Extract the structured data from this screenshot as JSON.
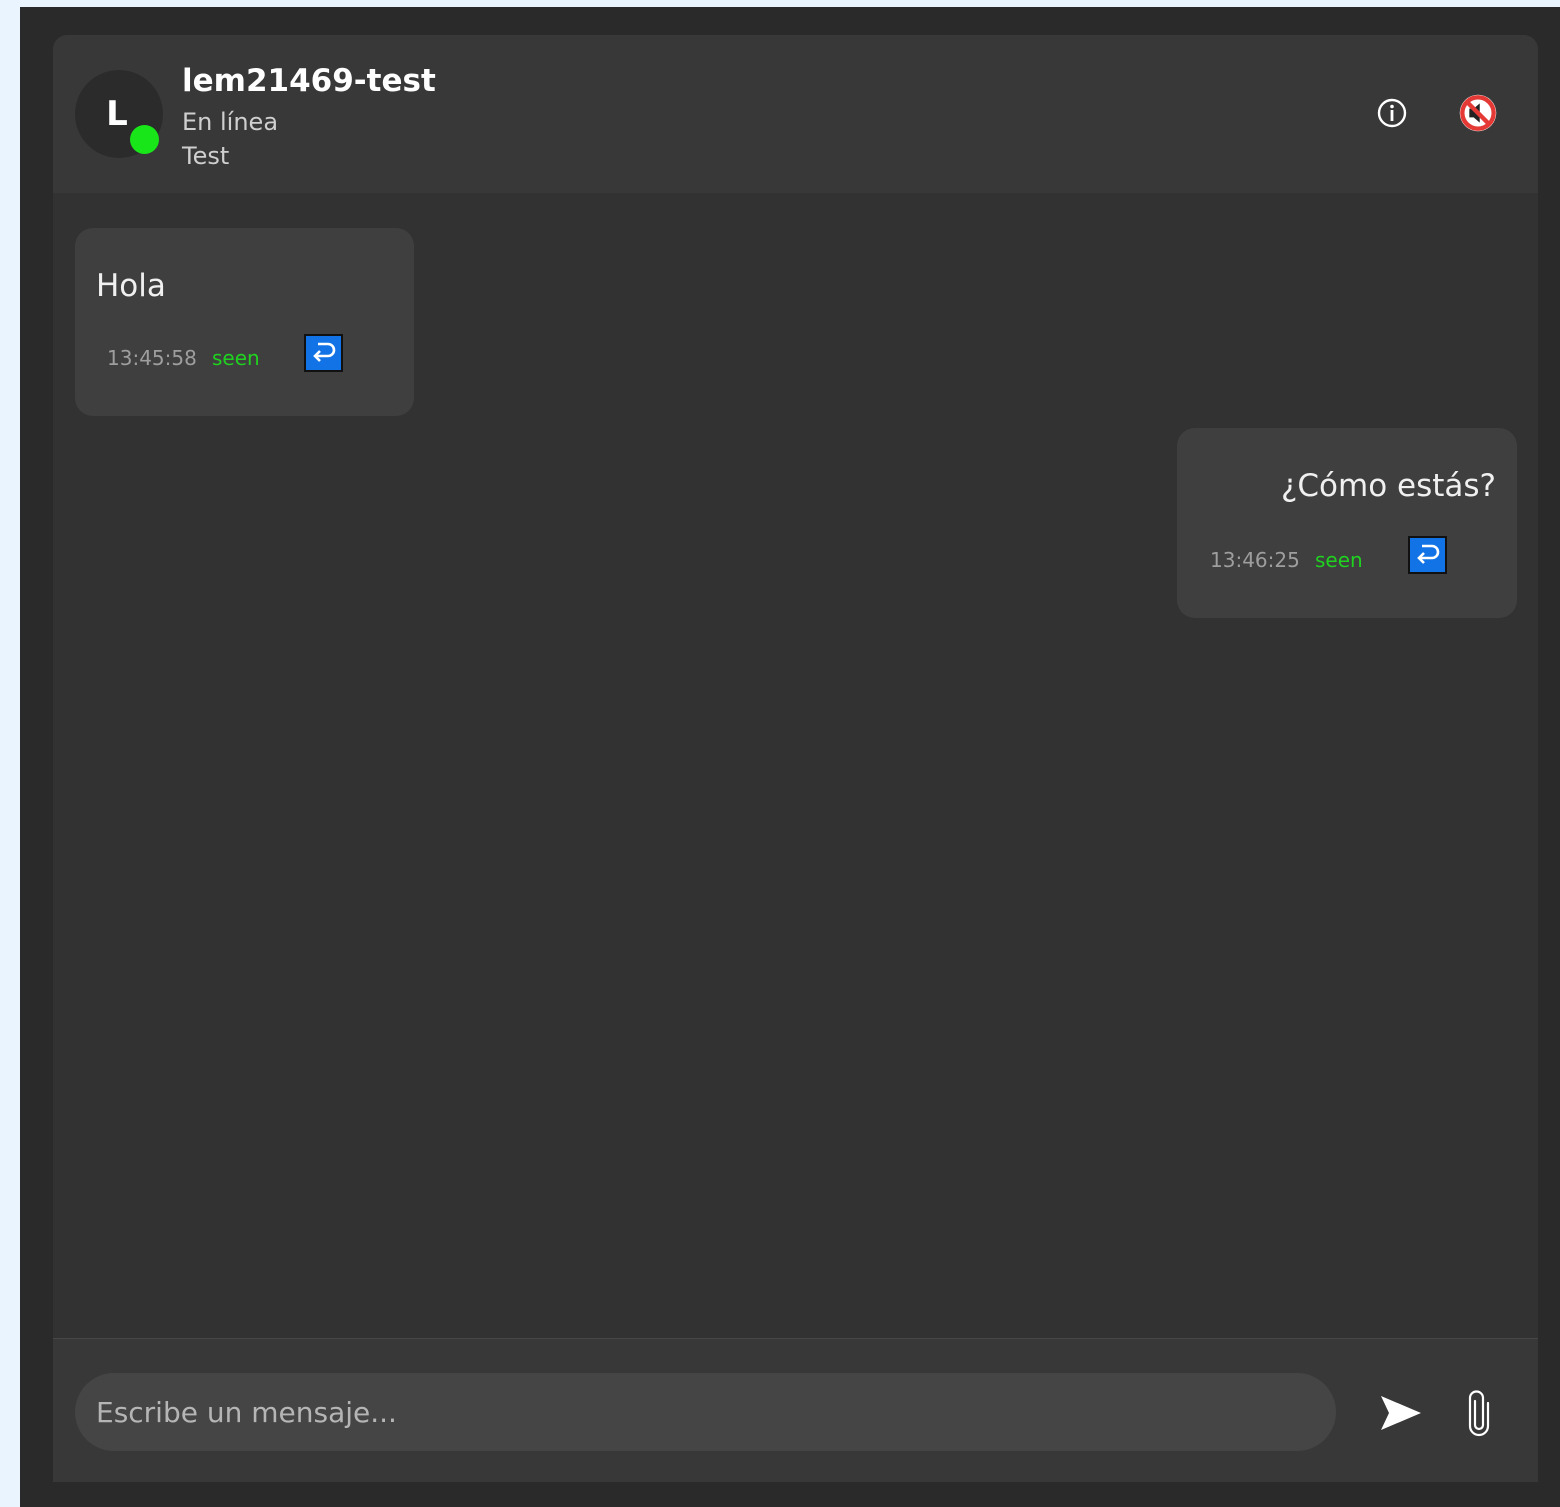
{
  "contact": {
    "initial": "L",
    "name": "lem21469-test",
    "status": "En línea",
    "description": "Test"
  },
  "header_icons": [
    "info-icon",
    "mute-icon"
  ],
  "messages": [
    {
      "text": "Hola",
      "time": "13:45:58",
      "status": "seen",
      "side": "left"
    },
    {
      "text": "¿Cómo estás?",
      "time": "13:46:25",
      "status": "seen",
      "side": "right"
    }
  ],
  "composer": {
    "placeholder": "Escribe un mensaje...",
    "icons": [
      "send-icon",
      "paperclip-icon"
    ]
  },
  "colors": {
    "online": "#19e619",
    "seen": "#1fd21f",
    "reply_button": "#1273e6",
    "mute_icon": "#e53935"
  }
}
